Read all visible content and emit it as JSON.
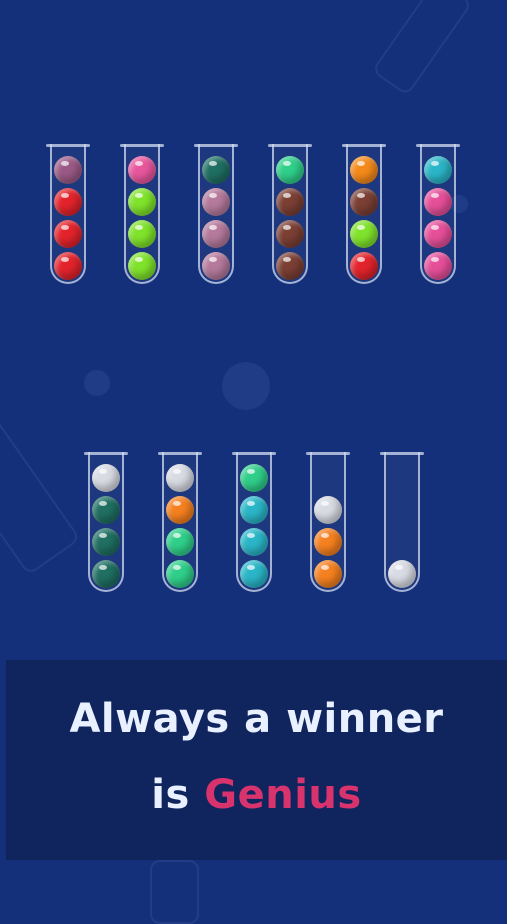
{
  "banner": {
    "line1": "Always a winner",
    "line2_prefix": "is ",
    "line2_accent": "Genius"
  },
  "colors": {
    "background": "#15307a",
    "banner": "#10255e",
    "accent": "#d8336d",
    "text": "#e9f0ff"
  },
  "tubes_top": [
    {
      "balls": [
        "#9b5a86",
        "#e3232b",
        "#e3232b",
        "#e3232b"
      ]
    },
    {
      "balls": [
        "#e8579e",
        "#7fe32b",
        "#7fe32b",
        "#7fe32b"
      ]
    },
    {
      "balls": [
        "#1f6f62",
        "#b57a9c",
        "#b57a9c",
        "#b57a9c"
      ]
    },
    {
      "balls": [
        "#2fcf8a",
        "#7b3f34",
        "#7b3f34",
        "#7b3f34"
      ]
    },
    {
      "balls": [
        "#f58a1a",
        "#7b3f34",
        "#7fe32b",
        "#e3232b"
      ]
    },
    {
      "balls": [
        "#2ab6c8",
        "#e64f9a",
        "#e64f9a",
        "#e64f9a"
      ]
    }
  ],
  "tubes_bottom": [
    {
      "balls": [
        "#d9dbe4",
        "#1f6f62",
        "#1f6f62",
        "#1f6f62"
      ]
    },
    {
      "balls": [
        "#d9dbe4",
        "#f5801f",
        "#2fcf8a",
        "#2fcf8a"
      ]
    },
    {
      "balls": [
        "#2fcf8a",
        "#2ab6c8",
        "#2ab6c8",
        "#2ab6c8"
      ]
    },
    {
      "balls": [
        "#d9dbe4",
        "#f5801f",
        "#f5801f"
      ]
    },
    {
      "balls": [
        "#d9dbe4"
      ]
    }
  ]
}
